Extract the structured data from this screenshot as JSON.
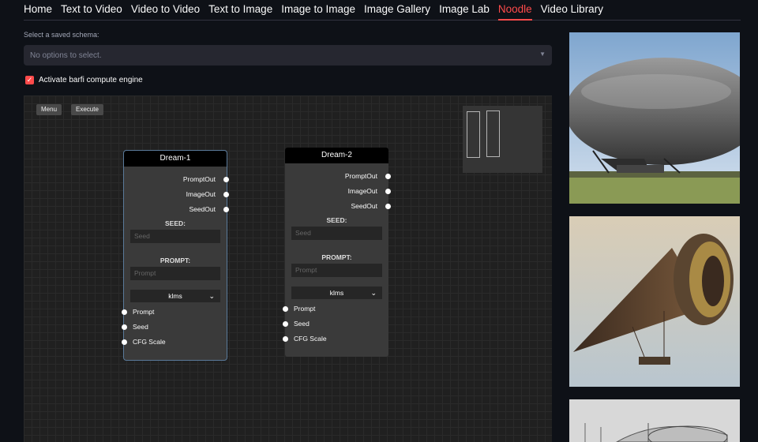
{
  "tabs": [
    "Home",
    "Text to Video",
    "Video to Video",
    "Text to Image",
    "Image to Image",
    "Image Gallery",
    "Image Lab",
    "Noodle",
    "Video Library"
  ],
  "active_tab": "Noodle",
  "schema": {
    "label": "Select a saved schema:",
    "placeholder": "No options to select."
  },
  "checkbox": {
    "label": "Activate barfi compute engine",
    "checked": true
  },
  "canvas": {
    "menu_label": "Menu",
    "execute_label": "Execute"
  },
  "nodes": [
    {
      "title": "Dream-1",
      "outputs": [
        "PromptOut",
        "ImageOut",
        "SeedOut"
      ],
      "seed_label": "SEED:",
      "seed_placeholder": "Seed",
      "prompt_label": "PROMPT:",
      "prompt_placeholder": "Prompt",
      "sampler": "klms",
      "inputs": [
        "Prompt",
        "Seed",
        "CFG Scale"
      ]
    },
    {
      "title": "Dream-2",
      "outputs": [
        "PromptOut",
        "ImageOut",
        "SeedOut"
      ],
      "seed_label": "SEED:",
      "seed_placeholder": "Seed",
      "prompt_label": "PROMPT:",
      "prompt_placeholder": "Prompt",
      "sampler": "klms",
      "inputs": [
        "Prompt",
        "Seed",
        "CFG Scale"
      ]
    }
  ],
  "gallery": [
    "airship-photo",
    "steampunk-airship-illustration",
    "airship-sketch"
  ],
  "colors": {
    "accent": "#ff4b4b",
    "background": "#0e1117",
    "canvas": "#202020"
  }
}
